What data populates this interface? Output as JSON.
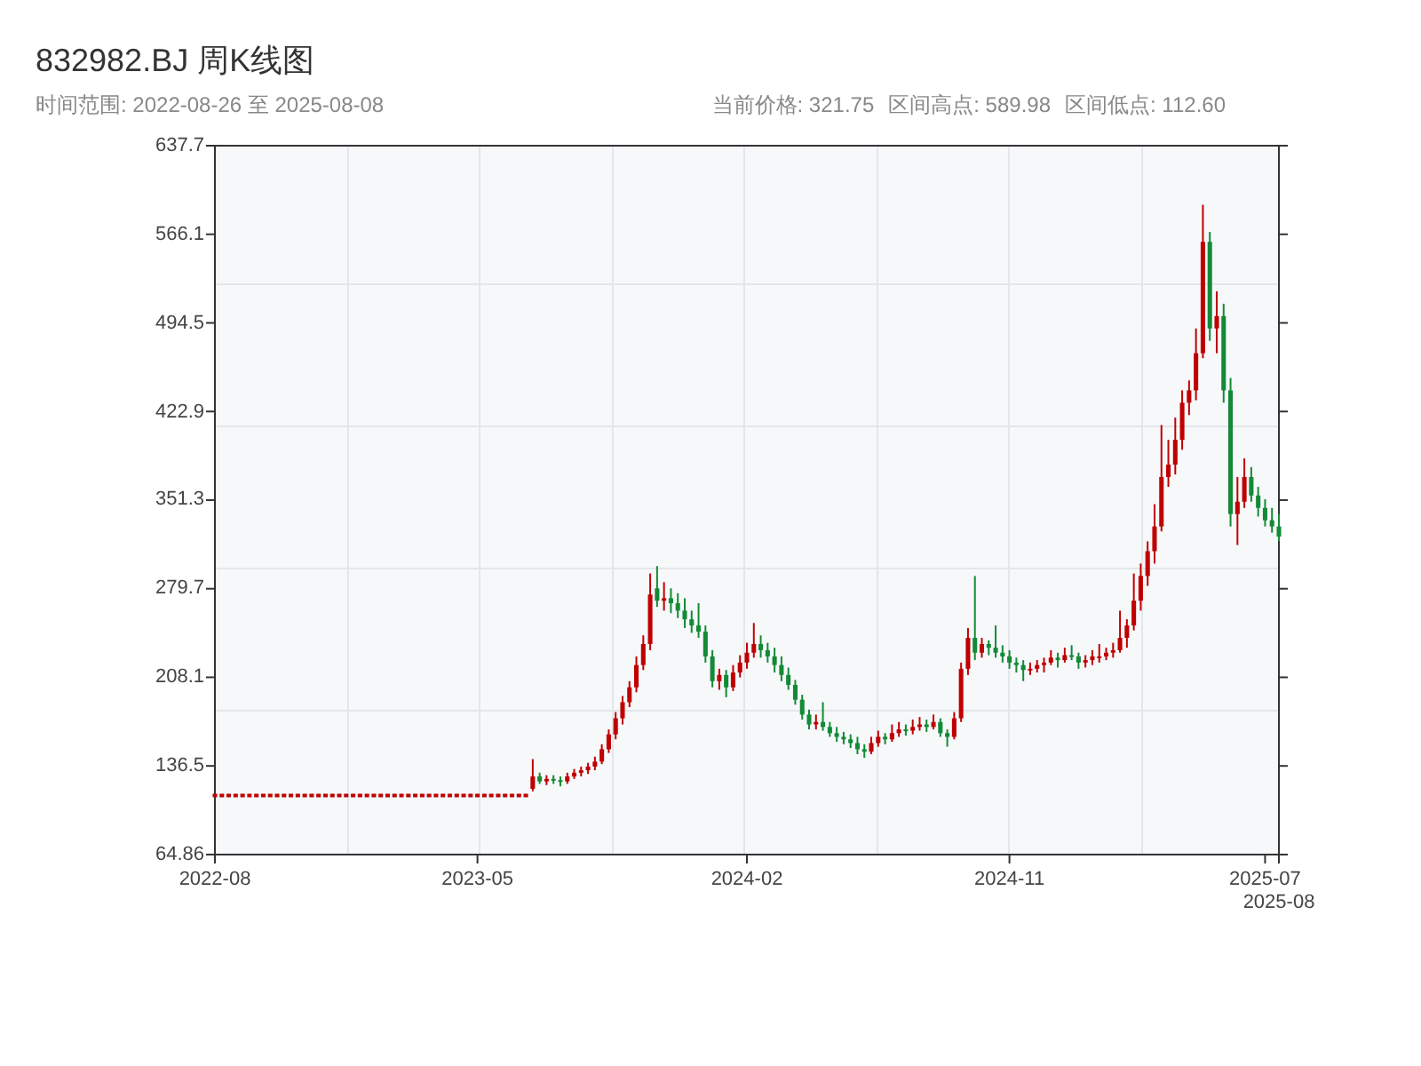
{
  "title": "832982.BJ 周K线图",
  "range": "时间范围: 2022-08-26 至 2025-08-08",
  "stats": [
    "当前价格: 321.75",
    "区间高点: 589.98",
    "区间低点: 112.60"
  ],
  "chart": {
    "chart_data": {
      "type": "candlestick",
      "categories": [
        "2022-08",
        null,
        null,
        null,
        null,
        null,
        null,
        null,
        null,
        null,
        null,
        null,
        null,
        null,
        null,
        null,
        null,
        null,
        null,
        null,
        null,
        null,
        null,
        null,
        null,
        null,
        null,
        null,
        null,
        null,
        null,
        null,
        null,
        null,
        null,
        null,
        null,
        null,
        "2023-05",
        null,
        null,
        null,
        null,
        null,
        null,
        null,
        null,
        null,
        null,
        null,
        null,
        null,
        null,
        null,
        null,
        null,
        null,
        null,
        null,
        null,
        null,
        null,
        null,
        null,
        null,
        null,
        null,
        null,
        null,
        null,
        null,
        null,
        null,
        null,
        null,
        null,
        null,
        "2024-02",
        null,
        null,
        null,
        null,
        null,
        null,
        null,
        null,
        null,
        null,
        null,
        null,
        null,
        null,
        null,
        null,
        null,
        null,
        null,
        null,
        null,
        null,
        null,
        null,
        null,
        null,
        null,
        null,
        null,
        null,
        null,
        null,
        null,
        null,
        null,
        null,
        null,
        "2024-11",
        null,
        null,
        null,
        null,
        null,
        null,
        null,
        null,
        null,
        null,
        null,
        null,
        null,
        null,
        null,
        null,
        null,
        null,
        null,
        null,
        null,
        null,
        null,
        null,
        null,
        null,
        null,
        null,
        null,
        null,
        null,
        null,
        null,
        null,
        null,
        null,
        "2025-07",
        null,
        "2025-08"
      ],
      "ohlc": [
        [
          112.6,
          112.6,
          112.6,
          112.6
        ],
        [
          112.6,
          112.6,
          112.6,
          112.6
        ],
        [
          112.6,
          112.6,
          112.6,
          112.6
        ],
        [
          112.6,
          112.6,
          112.6,
          112.6
        ],
        [
          112.6,
          112.6,
          112.6,
          112.6
        ],
        [
          112.6,
          112.6,
          112.6,
          112.6
        ],
        [
          112.6,
          112.6,
          112.6,
          112.6
        ],
        [
          112.6,
          112.6,
          112.6,
          112.6
        ],
        [
          112.6,
          112.6,
          112.6,
          112.6
        ],
        [
          112.6,
          112.6,
          112.6,
          112.6
        ],
        [
          112.6,
          112.6,
          112.6,
          112.6
        ],
        [
          112.6,
          112.6,
          112.6,
          112.6
        ],
        [
          112.6,
          112.6,
          112.6,
          112.6
        ],
        [
          112.6,
          112.6,
          112.6,
          112.6
        ],
        [
          112.6,
          112.6,
          112.6,
          112.6
        ],
        [
          112.6,
          112.6,
          112.6,
          112.6
        ],
        [
          112.6,
          112.6,
          112.6,
          112.6
        ],
        [
          112.6,
          112.6,
          112.6,
          112.6
        ],
        [
          112.6,
          112.6,
          112.6,
          112.6
        ],
        [
          112.6,
          112.6,
          112.6,
          112.6
        ],
        [
          112.6,
          112.6,
          112.6,
          112.6
        ],
        [
          112.6,
          112.6,
          112.6,
          112.6
        ],
        [
          112.6,
          112.6,
          112.6,
          112.6
        ],
        [
          112.6,
          112.6,
          112.6,
          112.6
        ],
        [
          112.6,
          112.6,
          112.6,
          112.6
        ],
        [
          112.6,
          112.6,
          112.6,
          112.6
        ],
        [
          112.6,
          112.6,
          112.6,
          112.6
        ],
        [
          112.6,
          112.6,
          112.6,
          112.6
        ],
        [
          112.6,
          112.6,
          112.6,
          112.6
        ],
        [
          112.6,
          112.6,
          112.6,
          112.6
        ],
        [
          112.6,
          112.6,
          112.6,
          112.6
        ],
        [
          112.6,
          112.6,
          112.6,
          112.6
        ],
        [
          112.6,
          112.6,
          112.6,
          112.6
        ],
        [
          112.6,
          112.6,
          112.6,
          112.6
        ],
        [
          112.6,
          112.6,
          112.6,
          112.6
        ],
        [
          112.6,
          112.6,
          112.6,
          112.6
        ],
        [
          112.6,
          112.6,
          112.6,
          112.6
        ],
        [
          112.6,
          112.6,
          112.6,
          112.6
        ],
        [
          112.6,
          112.6,
          112.6,
          112.6
        ],
        [
          112.6,
          112.6,
          112.6,
          112.6
        ],
        [
          112.6,
          112.6,
          112.6,
          112.6
        ],
        [
          112.6,
          112.6,
          112.6,
          112.6
        ],
        [
          112.6,
          112.6,
          112.6,
          112.6
        ],
        [
          112.6,
          112.6,
          112.6,
          112.6
        ],
        [
          112.6,
          112.6,
          112.6,
          112.6
        ],
        [
          112.6,
          112.6,
          112.6,
          112.6
        ],
        [
          118,
          142,
          116,
          128
        ],
        [
          128,
          131,
          122,
          124
        ],
        [
          124,
          129,
          121,
          126
        ],
        [
          126,
          129,
          122,
          125
        ],
        [
          125,
          128,
          120,
          124
        ],
        [
          124,
          131,
          122,
          128
        ],
        [
          128,
          134,
          126,
          131
        ],
        [
          131,
          136,
          128,
          133
        ],
        [
          133,
          139,
          130,
          136
        ],
        [
          136,
          144,
          133,
          140
        ],
        [
          140,
          154,
          138,
          150
        ],
        [
          150,
          166,
          147,
          162
        ],
        [
          162,
          180,
          158,
          175
        ],
        [
          175,
          193,
          170,
          188
        ],
        [
          188,
          205,
          184,
          200
        ],
        [
          200,
          225,
          196,
          218
        ],
        [
          218,
          242,
          214,
          235
        ],
        [
          235,
          292,
          230,
          275
        ],
        [
          280,
          298,
          265,
          270
        ],
        [
          270,
          285,
          262,
          272
        ],
        [
          272,
          280,
          260,
          268
        ],
        [
          268,
          276,
          256,
          262
        ],
        [
          262,
          272,
          248,
          255
        ],
        [
          255,
          262,
          244,
          250
        ],
        [
          250,
          268,
          240,
          245
        ],
        [
          245,
          250,
          220,
          225
        ],
        [
          225,
          230,
          200,
          205
        ],
        [
          205,
          215,
          198,
          210
        ],
        [
          210,
          214,
          192,
          200
        ],
        [
          200,
          218,
          197,
          212
        ],
        [
          212,
          226,
          208,
          220
        ],
        [
          220,
          236,
          215,
          228
        ],
        [
          228,
          252,
          224,
          235
        ],
        [
          235,
          242,
          224,
          230
        ],
        [
          230,
          236,
          220,
          225
        ],
        [
          225,
          232,
          212,
          218
        ],
        [
          218,
          225,
          205,
          210
        ],
        [
          210,
          216,
          198,
          202
        ],
        [
          202,
          206,
          186,
          190
        ],
        [
          190,
          194,
          174,
          178
        ],
        [
          178,
          182,
          166,
          170
        ],
        [
          170,
          178,
          166,
          172
        ],
        [
          172,
          188,
          165,
          168
        ],
        [
          168,
          172,
          160,
          163
        ],
        [
          163,
          168,
          156,
          160
        ],
        [
          160,
          164,
          154,
          158
        ],
        [
          158,
          162,
          151,
          155
        ],
        [
          155,
          160,
          146,
          150
        ],
        [
          150,
          154,
          143,
          148
        ],
        [
          148,
          160,
          146,
          155
        ],
        [
          155,
          165,
          152,
          160
        ],
        [
          160,
          163,
          154,
          158
        ],
        [
          158,
          170,
          156,
          163
        ],
        [
          163,
          172,
          160,
          166
        ],
        [
          166,
          170,
          161,
          165
        ],
        [
          165,
          174,
          162,
          168
        ],
        [
          168,
          176,
          165,
          170
        ],
        [
          170,
          174,
          164,
          168
        ],
        [
          168,
          178,
          166,
          172
        ],
        [
          172,
          175,
          160,
          163
        ],
        [
          163,
          166,
          152,
          160
        ],
        [
          160,
          180,
          158,
          175
        ],
        [
          175,
          220,
          172,
          215
        ],
        [
          215,
          248,
          210,
          240
        ],
        [
          240,
          290,
          222,
          228
        ],
        [
          228,
          240,
          224,
          235
        ],
        [
          235,
          238,
          226,
          232
        ],
        [
          232,
          250,
          224,
          228
        ],
        [
          228,
          234,
          220,
          225
        ],
        [
          225,
          230,
          215,
          220
        ],
        [
          220,
          224,
          212,
          218
        ],
        [
          218,
          222,
          205,
          214
        ],
        [
          214,
          220,
          210,
          215
        ],
        [
          215,
          222,
          212,
          218
        ],
        [
          218,
          224,
          212,
          220
        ],
        [
          220,
          230,
          218,
          224
        ],
        [
          224,
          228,
          216,
          222
        ],
        [
          222,
          232,
          220,
          226
        ],
        [
          226,
          234,
          222,
          225
        ],
        [
          225,
          228,
          215,
          220
        ],
        [
          220,
          226,
          216,
          222
        ],
        [
          222,
          230,
          218,
          225
        ],
        [
          225,
          235,
          220,
          225
        ],
        [
          225,
          232,
          222,
          228
        ],
        [
          228,
          236,
          224,
          230
        ],
        [
          230,
          262,
          228,
          240
        ],
        [
          240,
          255,
          232,
          250
        ],
        [
          250,
          292,
          246,
          270
        ],
        [
          270,
          300,
          262,
          290
        ],
        [
          290,
          318,
          282,
          310
        ],
        [
          310,
          348,
          300,
          330
        ],
        [
          330,
          412,
          326,
          370
        ],
        [
          370,
          400,
          362,
          380
        ],
        [
          380,
          418,
          372,
          400
        ],
        [
          400,
          440,
          392,
          430
        ],
        [
          430,
          448,
          420,
          440
        ],
        [
          440,
          490,
          432,
          470
        ],
        [
          470,
          589.98,
          466,
          560
        ],
        [
          560,
          568,
          480,
          490
        ],
        [
          490,
          520,
          470,
          500
        ],
        [
          500,
          510,
          430,
          440
        ],
        [
          440,
          450,
          330,
          340
        ],
        [
          340,
          370,
          315,
          350
        ],
        [
          350,
          385,
          345,
          370
        ],
        [
          370,
          378,
          350,
          355
        ],
        [
          355,
          362,
          338,
          345
        ],
        [
          345,
          352,
          330,
          335
        ],
        [
          335,
          345,
          325,
          330
        ],
        [
          330,
          340,
          318,
          321.75
        ]
      ],
      "ylim": [
        64.86,
        637.7
      ],
      "yticks": [
        637.7,
        566.1,
        494.5,
        422.9,
        351.3,
        279.7,
        208.1,
        136.5,
        64.86
      ]
    }
  }
}
